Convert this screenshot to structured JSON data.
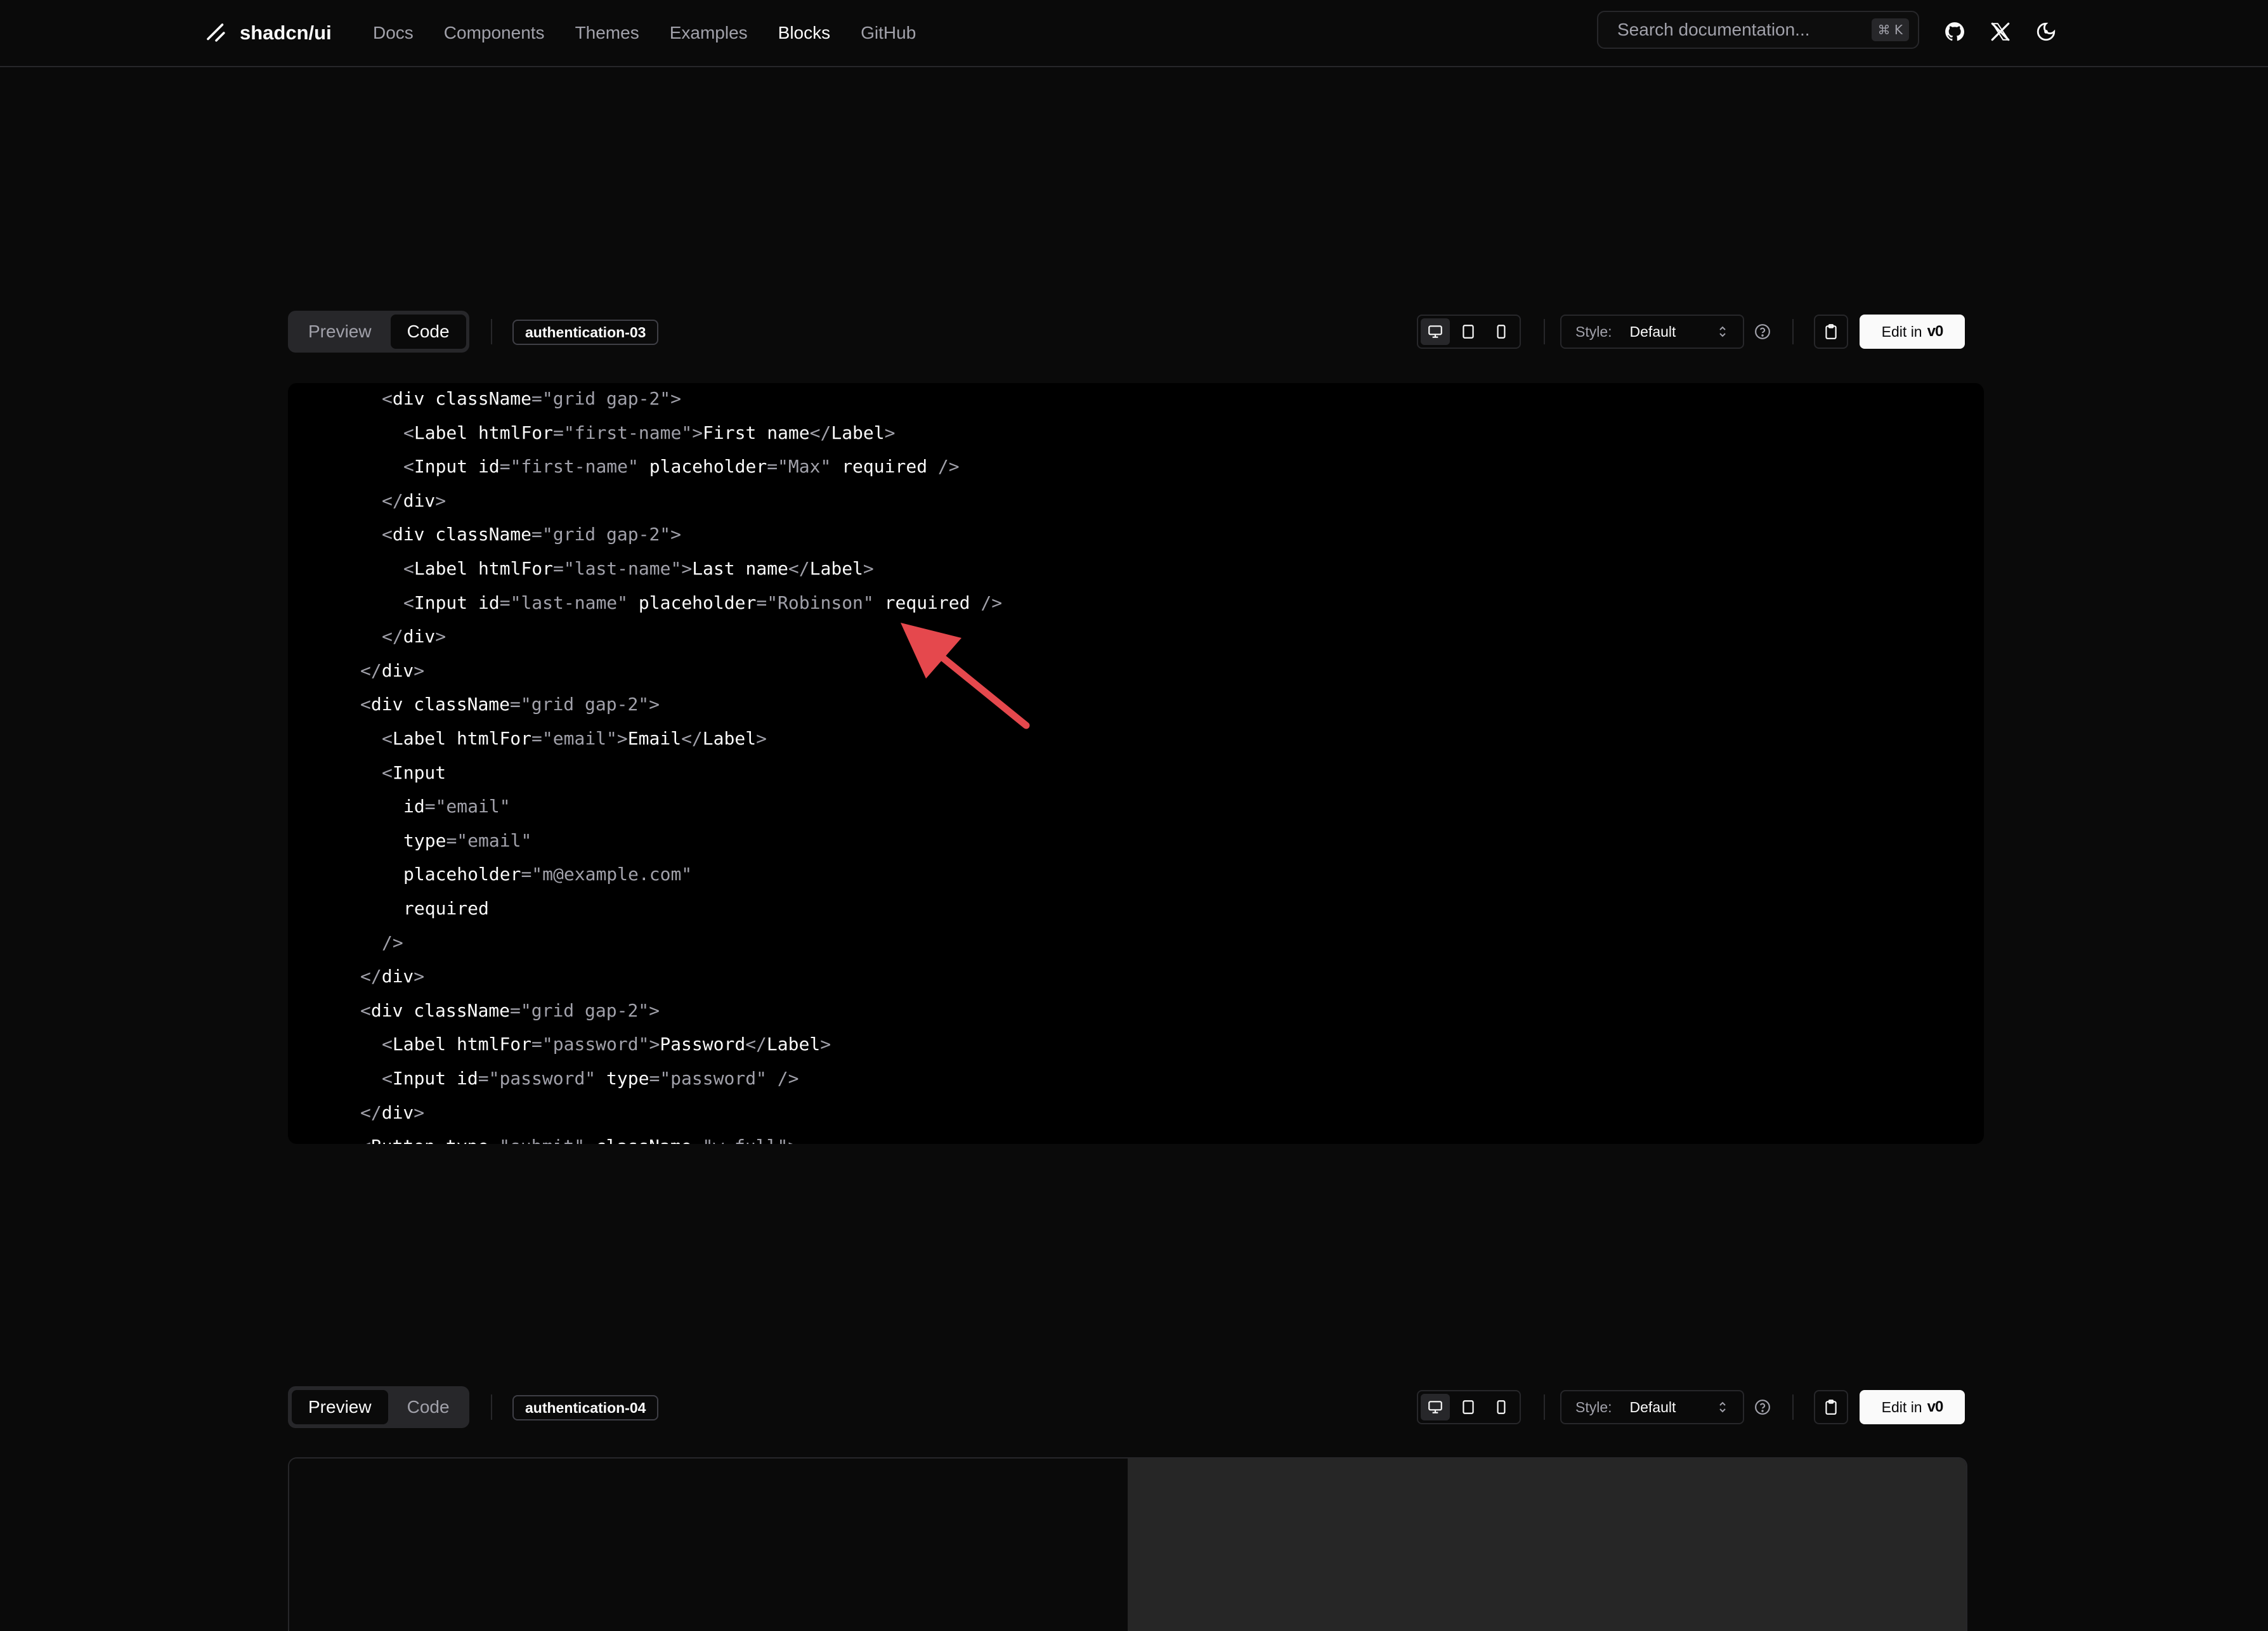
{
  "header": {
    "brand": "shadcn/ui",
    "nav": [
      "Docs",
      "Components",
      "Themes",
      "Examples",
      "Blocks",
      "GitHub"
    ],
    "active_nav": "Blocks",
    "search_placeholder": "Search documentation...",
    "search_shortcut": "⌘ K",
    "icons": [
      "github-icon",
      "x-icon",
      "theme-toggle-icon"
    ]
  },
  "block1": {
    "tabs": [
      "Preview",
      "Code"
    ],
    "selected_tab": "Code",
    "name": "authentication-03",
    "style_label": "Style:",
    "style_value": "Default",
    "edit_label": "Edit in",
    "edit_brand": "v0"
  },
  "block2": {
    "tabs": [
      "Preview",
      "Code"
    ],
    "selected_tab": "Preview",
    "name": "authentication-04",
    "style_label": "Style:",
    "style_value": "Default",
    "edit_label": "Edit in",
    "edit_brand": "v0"
  },
  "code": [
    {
      "indent": 4,
      "tokens": [
        [
          "punc",
          "<"
        ],
        [
          "tag",
          "div "
        ],
        [
          "attr",
          "className"
        ],
        [
          "punc",
          "="
        ],
        [
          "str",
          "\"grid gap-2\""
        ],
        [
          "punc",
          ">"
        ]
      ]
    },
    {
      "indent": 5,
      "tokens": [
        [
          "punc",
          "<"
        ],
        [
          "tag",
          "Label "
        ],
        [
          "attr",
          "htmlFor"
        ],
        [
          "punc",
          "="
        ],
        [
          "str",
          "\"first-name\""
        ],
        [
          "punc",
          ">"
        ],
        [
          "text",
          "First name"
        ],
        [
          "punc",
          "</"
        ],
        [
          "tag",
          "Label"
        ],
        [
          "punc",
          ">"
        ]
      ]
    },
    {
      "indent": 5,
      "tokens": [
        [
          "punc",
          "<"
        ],
        [
          "tag",
          "Input "
        ],
        [
          "attr",
          "id"
        ],
        [
          "punc",
          "="
        ],
        [
          "str",
          "\"first-name\""
        ],
        [
          "attr",
          " placeholder"
        ],
        [
          "punc",
          "="
        ],
        [
          "str",
          "\"Max\""
        ],
        [
          "attr",
          " required "
        ],
        [
          "punc",
          "/>"
        ]
      ]
    },
    {
      "indent": 4,
      "tokens": [
        [
          "punc",
          "</"
        ],
        [
          "tag",
          "div"
        ],
        [
          "punc",
          ">"
        ]
      ]
    },
    {
      "indent": 4,
      "tokens": [
        [
          "punc",
          "<"
        ],
        [
          "tag",
          "div "
        ],
        [
          "attr",
          "className"
        ],
        [
          "punc",
          "="
        ],
        [
          "str",
          "\"grid gap-2\""
        ],
        [
          "punc",
          ">"
        ]
      ]
    },
    {
      "indent": 5,
      "tokens": [
        [
          "punc",
          "<"
        ],
        [
          "tag",
          "Label "
        ],
        [
          "attr",
          "htmlFor"
        ],
        [
          "punc",
          "="
        ],
        [
          "str",
          "\"last-name\""
        ],
        [
          "punc",
          ">"
        ],
        [
          "text",
          "Last name"
        ],
        [
          "punc",
          "</"
        ],
        [
          "tag",
          "Label"
        ],
        [
          "punc",
          ">"
        ]
      ]
    },
    {
      "indent": 5,
      "tokens": [
        [
          "punc",
          "<"
        ],
        [
          "tag",
          "Input "
        ],
        [
          "attr",
          "id"
        ],
        [
          "punc",
          "="
        ],
        [
          "str",
          "\"last-name\""
        ],
        [
          "attr",
          " placeholder"
        ],
        [
          "punc",
          "="
        ],
        [
          "str",
          "\"Robinson\""
        ],
        [
          "attr",
          " required "
        ],
        [
          "punc",
          "/>"
        ]
      ]
    },
    {
      "indent": 4,
      "tokens": [
        [
          "punc",
          "</"
        ],
        [
          "tag",
          "div"
        ],
        [
          "punc",
          ">"
        ]
      ]
    },
    {
      "indent": 3,
      "tokens": [
        [
          "punc",
          "</"
        ],
        [
          "tag",
          "div"
        ],
        [
          "punc",
          ">"
        ]
      ]
    },
    {
      "indent": 3,
      "tokens": [
        [
          "punc",
          "<"
        ],
        [
          "tag",
          "div "
        ],
        [
          "attr",
          "className"
        ],
        [
          "punc",
          "="
        ],
        [
          "str",
          "\"grid gap-2\""
        ],
        [
          "punc",
          ">"
        ]
      ]
    },
    {
      "indent": 4,
      "tokens": [
        [
          "punc",
          "<"
        ],
        [
          "tag",
          "Label "
        ],
        [
          "attr",
          "htmlFor"
        ],
        [
          "punc",
          "="
        ],
        [
          "str",
          "\"email\""
        ],
        [
          "punc",
          ">"
        ],
        [
          "text",
          "Email"
        ],
        [
          "punc",
          "</"
        ],
        [
          "tag",
          "Label"
        ],
        [
          "punc",
          ">"
        ]
      ]
    },
    {
      "indent": 4,
      "tokens": [
        [
          "punc",
          "<"
        ],
        [
          "tag",
          "Input"
        ]
      ]
    },
    {
      "indent": 5,
      "tokens": [
        [
          "attr",
          "id"
        ],
        [
          "punc",
          "="
        ],
        [
          "str",
          "\"email\""
        ]
      ]
    },
    {
      "indent": 5,
      "tokens": [
        [
          "attr",
          "type"
        ],
        [
          "punc",
          "="
        ],
        [
          "str",
          "\"email\""
        ]
      ]
    },
    {
      "indent": 5,
      "tokens": [
        [
          "attr",
          "placeholder"
        ],
        [
          "punc",
          "="
        ],
        [
          "str",
          "\"m@example.com\""
        ]
      ]
    },
    {
      "indent": 5,
      "tokens": [
        [
          "attr",
          "required"
        ]
      ]
    },
    {
      "indent": 4,
      "tokens": [
        [
          "punc",
          "/>"
        ]
      ]
    },
    {
      "indent": 3,
      "tokens": [
        [
          "punc",
          "</"
        ],
        [
          "tag",
          "div"
        ],
        [
          "punc",
          ">"
        ]
      ]
    },
    {
      "indent": 3,
      "tokens": [
        [
          "punc",
          "<"
        ],
        [
          "tag",
          "div "
        ],
        [
          "attr",
          "className"
        ],
        [
          "punc",
          "="
        ],
        [
          "str",
          "\"grid gap-2\""
        ],
        [
          "punc",
          ">"
        ]
      ]
    },
    {
      "indent": 4,
      "tokens": [
        [
          "punc",
          "<"
        ],
        [
          "tag",
          "Label "
        ],
        [
          "attr",
          "htmlFor"
        ],
        [
          "punc",
          "="
        ],
        [
          "str",
          "\"password\""
        ],
        [
          "punc",
          ">"
        ],
        [
          "text",
          "Password"
        ],
        [
          "punc",
          "</"
        ],
        [
          "tag",
          "Label"
        ],
        [
          "punc",
          ">"
        ]
      ]
    },
    {
      "indent": 4,
      "tokens": [
        [
          "punc",
          "<"
        ],
        [
          "tag",
          "Input "
        ],
        [
          "attr",
          "id"
        ],
        [
          "punc",
          "="
        ],
        [
          "str",
          "\"password\""
        ],
        [
          "attr",
          " type"
        ],
        [
          "punc",
          "="
        ],
        [
          "str",
          "\"password\""
        ],
        [
          "punc",
          " />"
        ]
      ]
    },
    {
      "indent": 3,
      "tokens": [
        [
          "punc",
          "</"
        ],
        [
          "tag",
          "div"
        ],
        [
          "punc",
          ">"
        ]
      ]
    },
    {
      "indent": 3,
      "tokens": [
        [
          "punc",
          "<"
        ],
        [
          "tag",
          "Button "
        ],
        [
          "attr",
          "type"
        ],
        [
          "punc",
          "="
        ],
        [
          "str",
          "\"submit\""
        ],
        [
          "attr",
          " className"
        ],
        [
          "punc",
          "="
        ],
        [
          "str",
          "\"w-full\""
        ],
        [
          "punc",
          ">"
        ]
      ]
    }
  ],
  "colors": {
    "background": "#0a0a0a",
    "code_background": "#000000",
    "annotation_arrow": "#e5484d",
    "preview_right": "#262626"
  }
}
